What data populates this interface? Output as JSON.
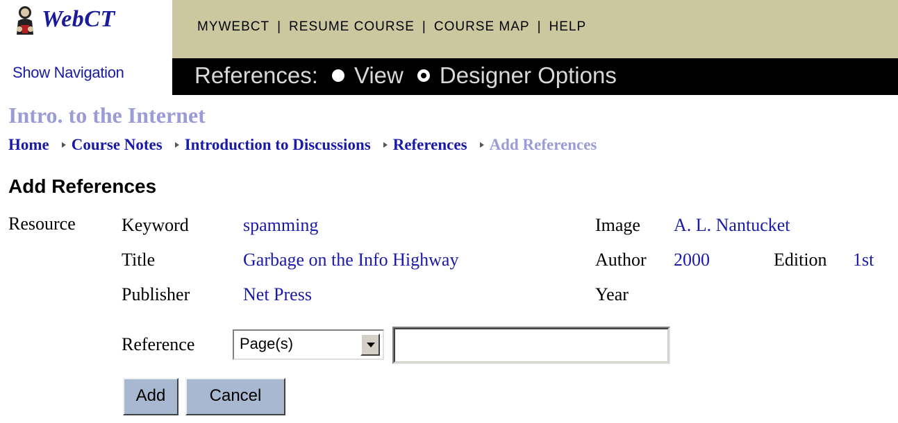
{
  "logo": {
    "text": "WebCT",
    "icon": "webct-logo-icon"
  },
  "topnav": {
    "items": [
      "MYWEBCT",
      "RESUME COURSE",
      "COURSE MAP",
      "HELP"
    ],
    "separator": "|"
  },
  "show_navigation": "Show Navigation",
  "toolbar": {
    "label": "References:",
    "options": [
      {
        "label": "View",
        "selected": false
      },
      {
        "label": "Designer Options",
        "selected": true
      }
    ]
  },
  "course_title": "Intro. to the Internet",
  "breadcrumb": [
    "Home",
    "Course Notes",
    "Introduction to Discussions",
    "References",
    "Add References"
  ],
  "page_heading": "Add References",
  "details": {
    "resource_label": "Resource",
    "keyword_label": "Keyword",
    "keyword_value": "spamming",
    "title_label": "Title",
    "title_value": "Garbage on the Info Highway",
    "publisher_label": "Publisher",
    "publisher_value": "Net Press",
    "image_label": "Image",
    "image_value": "A. L. Nantucket",
    "author_label": "Author",
    "author_value": "2000",
    "edition_label": "Edition",
    "edition_value": "1st",
    "year_label": "Year"
  },
  "form": {
    "reference_label": "Reference",
    "reference_type": "Page(s)",
    "reference_value": "",
    "add_label": "Add",
    "cancel_label": "Cancel"
  },
  "colors": {
    "topnav_bg": "#cbc8a0",
    "link": "#1a1aa8",
    "muted_link": "#9b9bd6",
    "button_bg": "#a8b8d0"
  }
}
